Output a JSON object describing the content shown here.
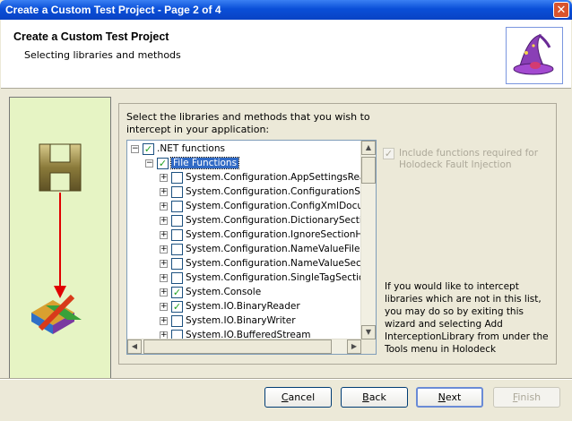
{
  "window": {
    "title": "Create a Custom Test Project - Page 2 of 4",
    "close_glyph": "✕"
  },
  "header": {
    "title": "Create a Custom Test Project",
    "subtitle": "Selecting libraries and methods"
  },
  "instructions": "Select the libraries and methods that you wish to intercept in your application:",
  "tree": {
    "items": [
      {
        "label": ".NET functions",
        "expander": "−",
        "checked": true,
        "level": 0
      },
      {
        "label": "File Functions",
        "expander": "−",
        "checked": true,
        "level": 1,
        "selected": true
      },
      {
        "label": "System.Configuration.AppSettingsRea",
        "expander": "+",
        "checked": false,
        "level": 2
      },
      {
        "label": "System.Configuration.ConfigurationSe",
        "expander": "+",
        "checked": false,
        "level": 2
      },
      {
        "label": "System.Configuration.ConfigXmlDocum",
        "expander": "+",
        "checked": false,
        "level": 2
      },
      {
        "label": "System.Configuration.DictionarySection",
        "expander": "+",
        "checked": false,
        "level": 2
      },
      {
        "label": "System.Configuration.IgnoreSectionHa",
        "expander": "+",
        "checked": false,
        "level": 2
      },
      {
        "label": "System.Configuration.NameValueFileSe",
        "expander": "+",
        "checked": false,
        "level": 2
      },
      {
        "label": "System.Configuration.NameValueSectio",
        "expander": "+",
        "checked": false,
        "level": 2
      },
      {
        "label": "System.Configuration.SingleTagSection",
        "expander": "+",
        "checked": false,
        "level": 2
      },
      {
        "label": "System.Console",
        "expander": "+",
        "checked": true,
        "level": 2
      },
      {
        "label": "System.IO.BinaryReader",
        "expander": "+",
        "checked": true,
        "level": 2
      },
      {
        "label": "System.IO.BinaryWriter",
        "expander": "+",
        "checked": false,
        "level": 2
      },
      {
        "label": "System.IO.BufferedStream",
        "expander": "+",
        "checked": false,
        "level": 2
      }
    ],
    "check_glyph": "✓"
  },
  "scroll_glyphs": {
    "up": "▲",
    "down": "▼",
    "left": "◀",
    "right": "▶"
  },
  "include_option": {
    "label": "Include functions required for Holodeck Fault Injection",
    "checked": true,
    "enabled": false
  },
  "info_text": "If you would like to intercept libraries which are not in this list, you may do so by exiting this wizard and selecting Add InterceptionLibrary from under the Tools menu in Holodeck",
  "buttons": {
    "cancel": {
      "first": "C",
      "rest": "ancel"
    },
    "back": {
      "first": "B",
      "rest": "ack"
    },
    "next": {
      "first": "N",
      "rest": "ext"
    },
    "finish": {
      "first": "F",
      "rest": "inish"
    }
  },
  "colors": {
    "accent": "#0a4fd8",
    "left_panel": "#e6f4c4",
    "selection": "#316ac5",
    "arrow": "#e00000"
  }
}
